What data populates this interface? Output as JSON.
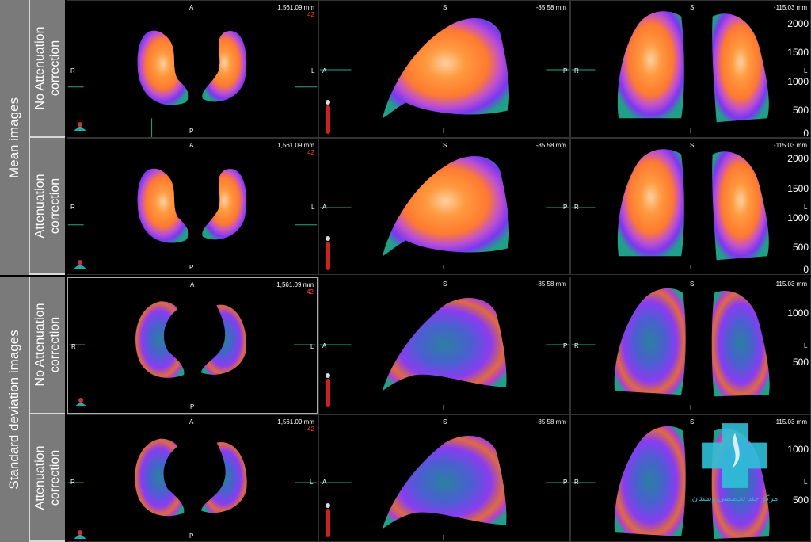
{
  "groups": {
    "mean": "Mean images",
    "sd": "Standard deviation images"
  },
  "rows": [
    {
      "label": "No Attenuation\ncorrection",
      "slice": "42"
    },
    {
      "label": "Attenuation\ncorrection",
      "slice": "42"
    },
    {
      "label": "No Attenuation\ncorrection",
      "slice": "42"
    },
    {
      "label": "Attenuation\ncorrection",
      "slice": "42"
    }
  ],
  "views": {
    "transverse": {
      "top": "A",
      "bottom": "P",
      "left": "R",
      "right": "L",
      "distance": "1,561.09 mm"
    },
    "sagittal": {
      "top": "S",
      "bottom": "I",
      "left": "A",
      "right": "P",
      "distance": "-85.58 mm"
    },
    "coronal": {
      "top": "S",
      "bottom": "I",
      "left": "R",
      "right": "L",
      "distance": "-115.03 mm"
    }
  },
  "scales": {
    "mean_row1": [
      "2000",
      "1500",
      "1000",
      "500",
      "0"
    ],
    "mean_row2": [
      "2000",
      "1500",
      "1000",
      "500",
      "0"
    ],
    "sd_row1": [
      "1000",
      "500"
    ],
    "sd_row2": [
      "1000",
      "500"
    ]
  },
  "colors": {
    "hot": "#ffb070",
    "orange": "#ff8a2a",
    "purple": "#8a3cf0",
    "blue": "#3a70b8",
    "teal": "#1fa890",
    "label_bg": "#7a7a7a",
    "slice_red": "#ff4040"
  },
  "logo": {
    "text": "مرکز چند تخصصی ویستان"
  }
}
